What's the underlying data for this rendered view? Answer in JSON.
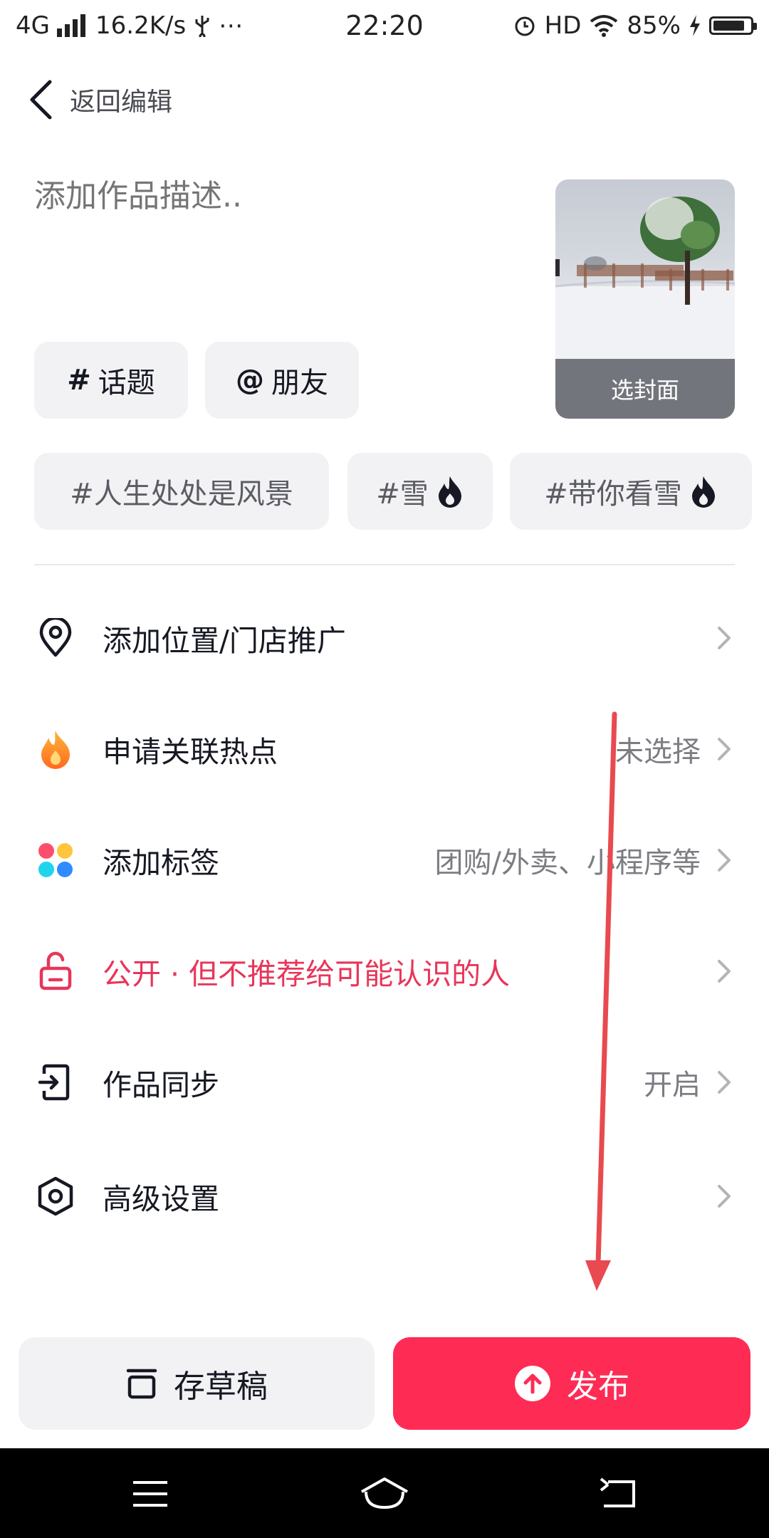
{
  "status": {
    "network": "4G",
    "speed": "16.2K/s",
    "time": "22:20",
    "hd": "HD",
    "battery": "85%",
    "battery_level": 0.85
  },
  "header": {
    "back_label": "返回编辑"
  },
  "description": {
    "placeholder": "添加作品描述.."
  },
  "cover": {
    "label": "选封面"
  },
  "chips": {
    "topic": "话题",
    "topic_prefix": "#",
    "friend": "朋友",
    "friend_prefix": "@"
  },
  "suggested_tags": [
    {
      "text": "#人生处处是风景",
      "hot": false
    },
    {
      "text": "#雪",
      "hot": true
    },
    {
      "text": "#带你看雪",
      "hot": true
    }
  ],
  "rows": [
    {
      "icon": "location-pin-icon",
      "label": "添加位置/门店推广",
      "value": ""
    },
    {
      "icon": "flame-icon",
      "label": "申请关联热点",
      "value": "未选择"
    },
    {
      "icon": "four-dots-icon",
      "label": "添加标签",
      "value": "团购/外卖、小程序等"
    },
    {
      "icon": "unlock-icon",
      "label": "公开 · 但不推荐给可能认识的人",
      "value": ""
    },
    {
      "icon": "sync-export-icon",
      "label": "作品同步",
      "value": "开启"
    },
    {
      "icon": "hexagon-gear-icon",
      "label": "高级设置",
      "value": ""
    }
  ],
  "buttons": {
    "draft": "存草稿",
    "publish": "发布"
  },
  "colors": {
    "accent": "#fe2c55",
    "privacy": "#e8355a",
    "annotation_arrow": "#e84a4f"
  }
}
